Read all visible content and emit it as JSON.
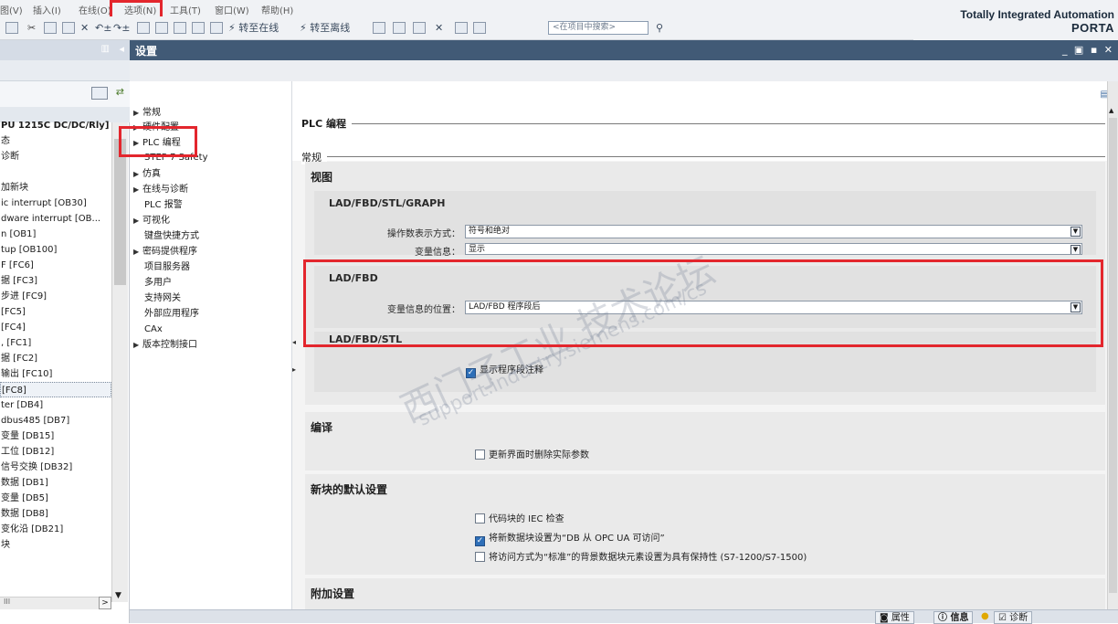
{
  "menu": {
    "items": [
      "图(V)",
      "插入(I)",
      "在线(O)",
      "选项(N)",
      "工具(T)",
      "窗口(W)",
      "帮助(H)"
    ]
  },
  "toolbar": {
    "go_online": "转至在线",
    "go_offline": "转至离线",
    "search_placeholder": "<在项目中搜索>"
  },
  "brand": {
    "line1": "Totally Integrated Automation",
    "line2": "PORTA"
  },
  "tree": {
    "items": [
      "",
      "",
      "PU 1215C DC/DC/Rly]",
      "态",
      "诊断",
      "",
      "加新块",
      "ic interrupt [OB30]",
      "dware interrupt [OB...",
      "n [OB1]",
      "tup [OB100]",
      "F [FC6]",
      "据 [FC3]",
      "步进 [FC9]",
      "[FC5]",
      "[FC4]",
      ", [FC1]",
      "据 [FC2]",
      "输出 [FC10]",
      "[FC8]",
      "ter [DB4]",
      "dbus485 [DB7]",
      "变量 [DB15]",
      "工位 [DB12]",
      "信号交换 [DB32]",
      "数据 [DB1]",
      "变量 [DB5]",
      "数据 [DB8]",
      "变化沿 [DB21]",
      "块"
    ],
    "hscroll_label": "III"
  },
  "panel": {
    "title": "设置"
  },
  "nav": {
    "items": [
      {
        "label": "常规",
        "expandable": true
      },
      {
        "label": "硬件配置",
        "expandable": true
      },
      {
        "label": "PLC 编程",
        "expandable": true
      },
      {
        "label": "STEP 7 Safety",
        "expandable": false
      },
      {
        "label": "仿真",
        "expandable": true
      },
      {
        "label": "在线与诊断",
        "expandable": true
      },
      {
        "label": "PLC 报警",
        "expandable": false
      },
      {
        "label": "可视化",
        "expandable": true
      },
      {
        "label": "键盘快捷方式",
        "expandable": false
      },
      {
        "label": "密码提供程序",
        "expandable": true
      },
      {
        "label": "项目服务器",
        "expandable": false
      },
      {
        "label": "多用户",
        "expandable": false
      },
      {
        "label": "支持网关",
        "expandable": false
      },
      {
        "label": "外部应用程序",
        "expandable": false
      },
      {
        "label": "CAx",
        "expandable": false
      },
      {
        "label": "版本控制接口",
        "expandable": true
      }
    ]
  },
  "content": {
    "section_title": "PLC 编程",
    "subsection_title": "常规",
    "view": {
      "title": "视图",
      "ladgraph": {
        "title": "LAD/FBD/STL/GRAPH",
        "operand_label": "操作数表示方式：",
        "operand_value": "符号和绝对",
        "tag_info_label": "变量信息：",
        "tag_info_value": "显示"
      },
      "ladfbd": {
        "title": "LAD/FBD",
        "position_label": "变量信息的位置：",
        "position_value": "LAD/FBD 程序段后"
      },
      "ladfbdstl": {
        "title": "LAD/FBD/STL",
        "show_comments": "显示程序段注释",
        "show_comments_checked": true
      }
    },
    "compile": {
      "title": "编译",
      "delete_params": "更新界面时删除实际参数",
      "delete_params_checked": false
    },
    "new_block": {
      "title": "新块的默认设置",
      "iec_check": "代码块的 IEC 检查",
      "iec_check_checked": false,
      "opc_ua": "将新数据块设置为“DB 从 OPC UA 可访问”",
      "opc_ua_checked": true,
      "retain": "将访问方式为“标准”的背景数据块元素设置为具有保持性 (S7-1200/S7-1500)",
      "retain_checked": false
    },
    "additional": {
      "title": "附加设置"
    }
  },
  "watermark": {
    "line1": "西门子工业 技术论坛",
    "line2": "support.industry.siemens.com/cs"
  },
  "bottom": {
    "properties": "属性",
    "info": "信息",
    "diagnostics": "诊断"
  },
  "colors": {
    "title_bar": "#415a76",
    "highlight_red": "#e3262d",
    "checkbox_on": "#2e6fb8"
  }
}
